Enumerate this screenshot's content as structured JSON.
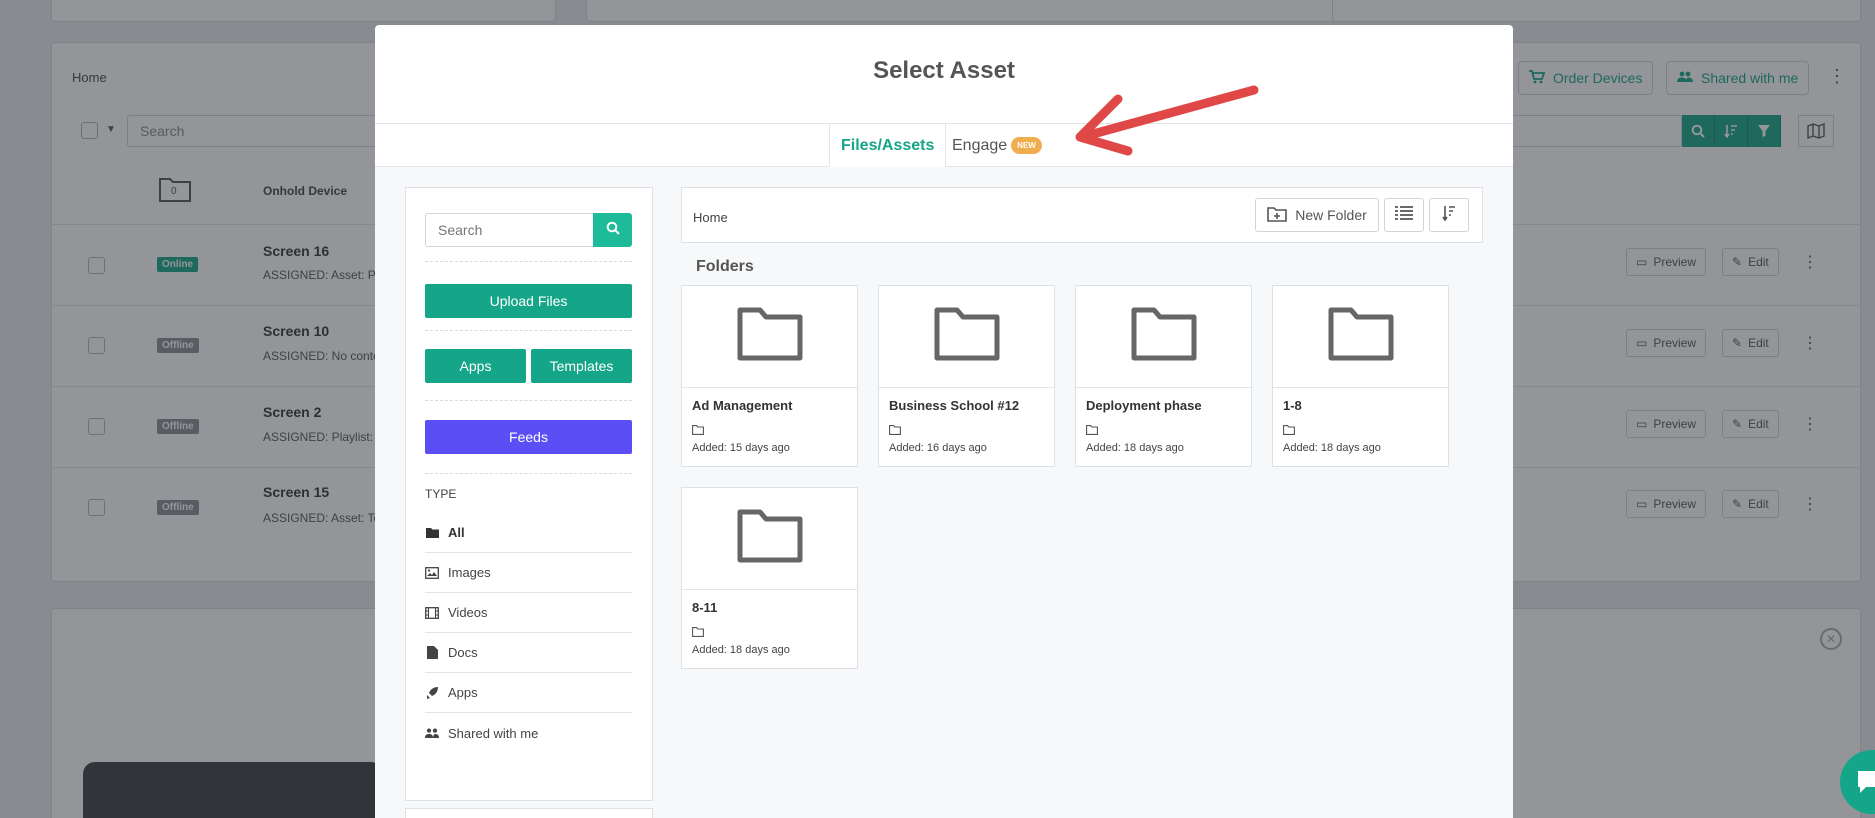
{
  "background": {
    "breadcrumb": "Home",
    "order_devices_label": "Order Devices",
    "shared_with_me_label": "Shared with me",
    "search_placeholder": "Search",
    "onhold_count": "0",
    "onhold_label": "Onhold Device",
    "preview_label": "Preview",
    "edit_label": "Edit",
    "rows": [
      {
        "status": "Online",
        "name": "Screen 16",
        "assigned": "ASSIGNED: Asset: Pe"
      },
      {
        "status": "Offline",
        "name": "Screen 10",
        "assigned": "ASSIGNED: No conte"
      },
      {
        "status": "Offline",
        "name": "Screen 2",
        "assigned": "ASSIGNED: Playlist: #"
      },
      {
        "status": "Offline",
        "name": "Screen 15",
        "assigned": "ASSIGNED: Asset: Te"
      }
    ],
    "colors": {
      "online": "#15a589",
      "offline": "#8a8f94"
    }
  },
  "modal": {
    "title": "Select Asset",
    "tabs": [
      {
        "label": "Files/Assets",
        "active": true
      },
      {
        "label": "Engage",
        "badge": "NEW",
        "active": false
      }
    ],
    "sidebar": {
      "search_placeholder": "Search",
      "upload_label": "Upload Files",
      "apps_label": "Apps",
      "templates_label": "Templates",
      "feeds_label": "Feeds",
      "type_heading": "TYPE",
      "types": [
        {
          "label": "All",
          "icon": "folder-icon",
          "active": true
        },
        {
          "label": "Images",
          "icon": "image-icon"
        },
        {
          "label": "Videos",
          "icon": "film-icon"
        },
        {
          "label": "Docs",
          "icon": "document-icon"
        },
        {
          "label": "Apps",
          "icon": "rocket-icon"
        },
        {
          "label": "Shared with me",
          "icon": "users-icon"
        }
      ]
    },
    "main": {
      "breadcrumb": "Home",
      "new_folder_label": "New Folder",
      "folders_heading": "Folders",
      "folders": [
        {
          "name": "Ad Management",
          "added": "Added: 15 days ago"
        },
        {
          "name": "Business School #12",
          "added": "Added: 16 days ago"
        },
        {
          "name": "Deployment phase",
          "added": "Added: 18 days ago"
        },
        {
          "name": "1-8",
          "added": "Added: 18 days ago"
        },
        {
          "name": "8-11",
          "added": "Added: 18 days ago"
        }
      ]
    }
  },
  "colors": {
    "accent": "#15a589",
    "feeds": "#5b4ef5",
    "badge": "#f0ad4e",
    "annotation_arrow": "#e04848"
  }
}
